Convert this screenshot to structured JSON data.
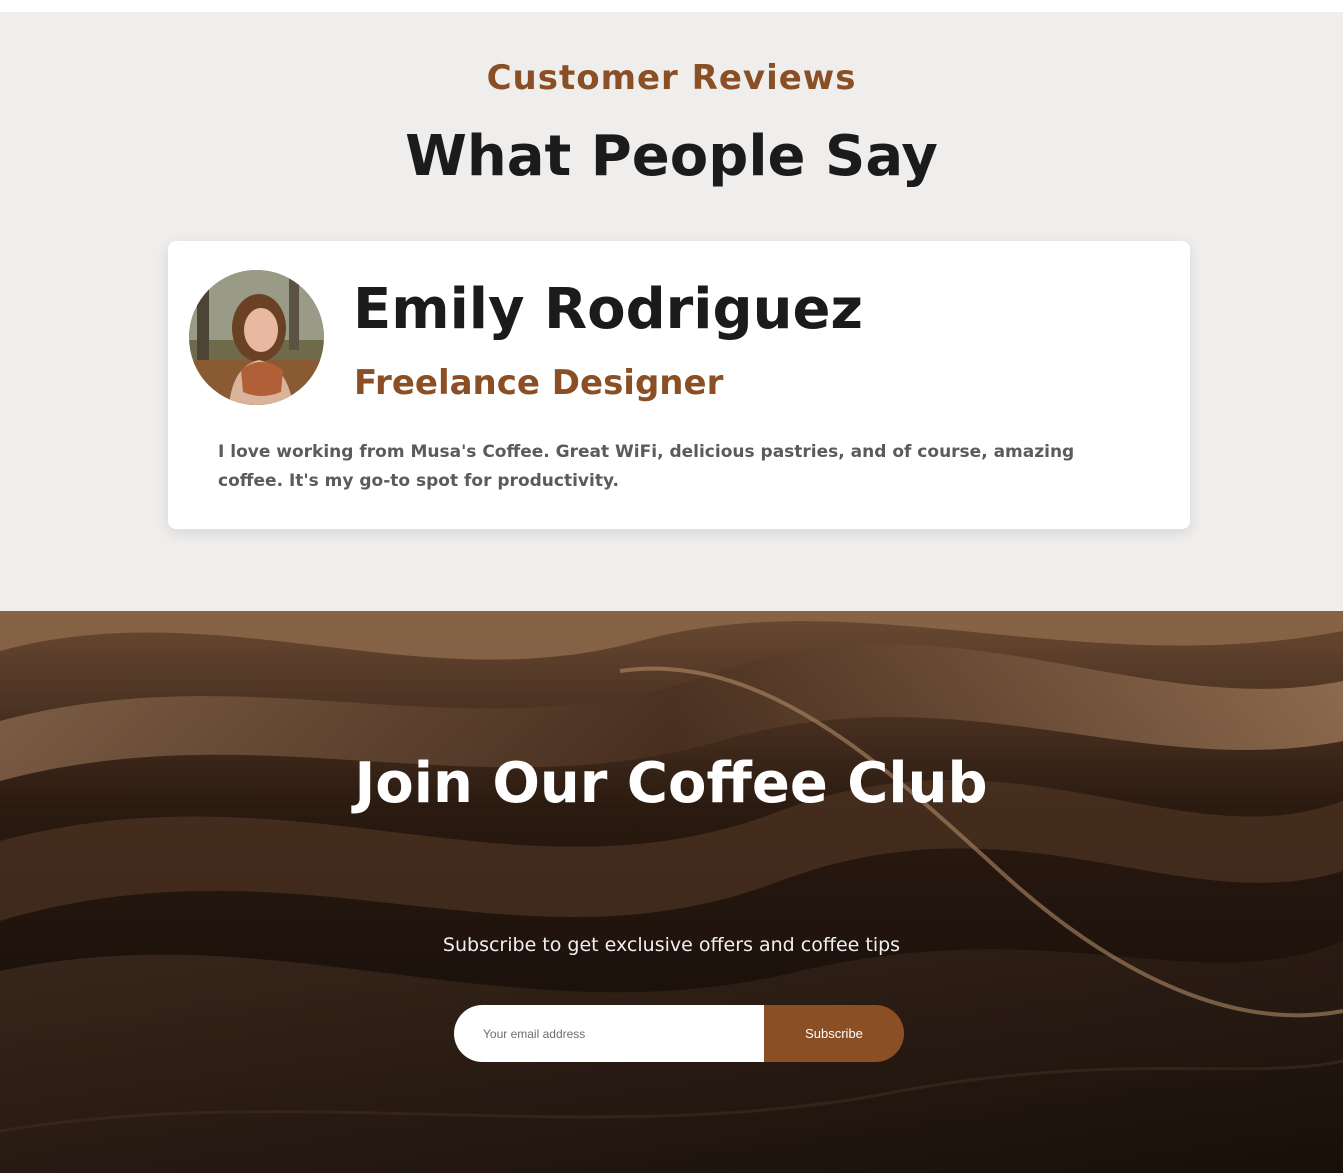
{
  "colors": {
    "accent": "#8a4f24",
    "heading": "#1b1b1b",
    "section_bg": "#efeeec"
  },
  "reviews": {
    "eyebrow": "Customer Reviews",
    "title": "What People Say",
    "review": {
      "avatar": "reviewer-photo",
      "name": "Emily Rodriguez",
      "role": "Freelance Designer",
      "text": "I love working from Musa's Coffee. Great WiFi, delicious pastries, and of course, amazing coffee. It's my go-to spot for productivity."
    }
  },
  "club": {
    "title": "Join Our Coffee Club",
    "subtitle": "Subscribe to get exclusive offers and coffee tips",
    "email_placeholder": "Your email address",
    "button_label": "Subscribe"
  }
}
